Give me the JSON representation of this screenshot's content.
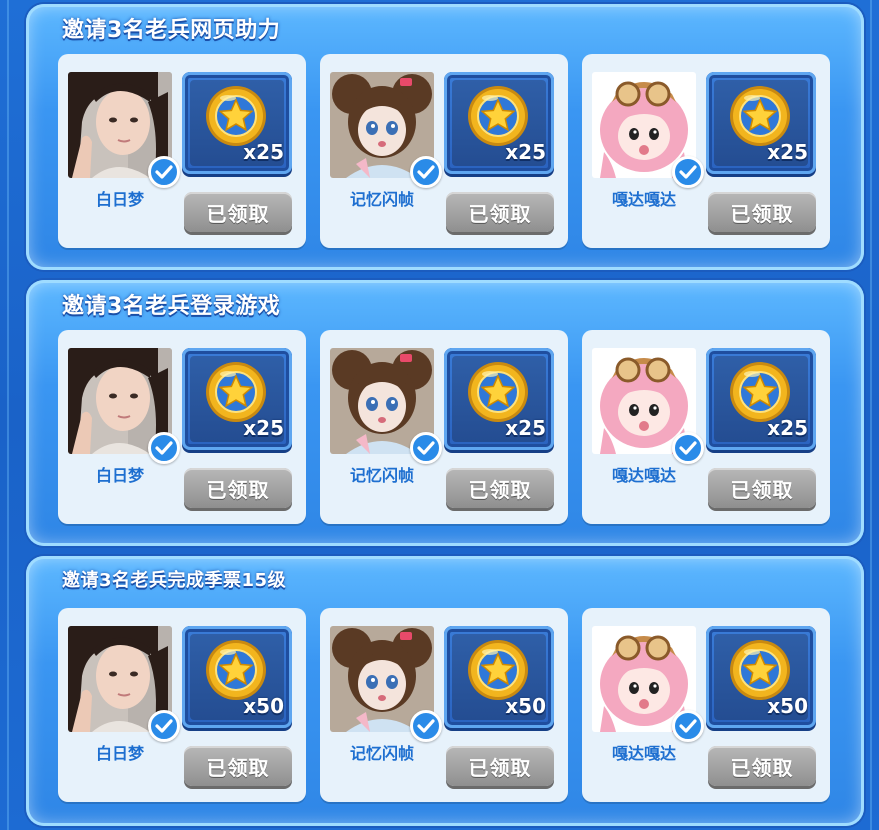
{
  "sections": [
    {
      "title": "邀请3名老兵网页助力",
      "cards": [
        {
          "name": "白日梦",
          "qty": "x25",
          "status": "已领取",
          "avatar": "photo-girl"
        },
        {
          "name": "记忆闪帧",
          "qty": "x25",
          "status": "已领取",
          "avatar": "doll-brown-hair"
        },
        {
          "name": "嘎达嘎达",
          "qty": "x25",
          "status": "已领取",
          "avatar": "chibi-pink-hair"
        }
      ]
    },
    {
      "title": "邀请3名老兵登录游戏",
      "cards": [
        {
          "name": "白日梦",
          "qty": "x25",
          "status": "已领取",
          "avatar": "photo-girl"
        },
        {
          "name": "记忆闪帧",
          "qty": "x25",
          "status": "已领取",
          "avatar": "doll-brown-hair"
        },
        {
          "name": "嘎达嘎达",
          "qty": "x25",
          "status": "已领取",
          "avatar": "chibi-pink-hair"
        }
      ]
    },
    {
      "title": "邀请3名老兵完成季票15级",
      "cards": [
        {
          "name": "白日梦",
          "qty": "x50",
          "status": "已领取",
          "avatar": "photo-girl"
        },
        {
          "name": "记忆闪帧",
          "qty": "x50",
          "status": "已领取",
          "avatar": "doll-brown-hair"
        },
        {
          "name": "嘎达嘎达",
          "qty": "x50",
          "status": "已领取",
          "avatar": "chibi-pink-hair"
        }
      ]
    }
  ],
  "reward_icon": "gold-star-coin-icon",
  "check_icon": "checkmark-icon",
  "colors": {
    "background": "#1f6fd6",
    "panel": "#3a96f2",
    "card": "#e7f2fb",
    "name_text": "#1e6fd0",
    "claimed_button": "#a3a3a3",
    "coin_gold": "#f2b51e"
  }
}
